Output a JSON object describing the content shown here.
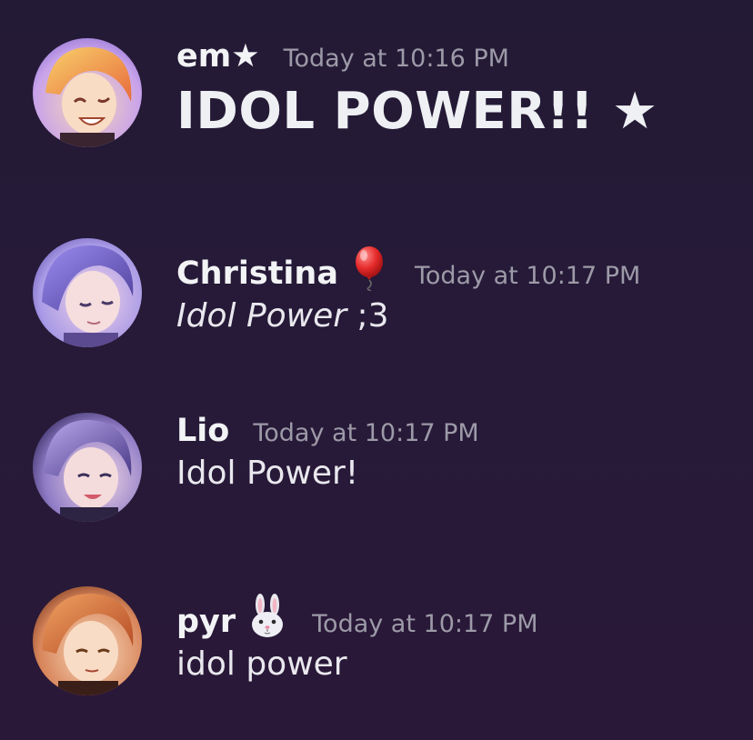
{
  "messages": [
    {
      "username": "em★",
      "username_emoji": "",
      "timestamp": "Today at 10:16 PM",
      "content": "IDOL POWER!! ★",
      "content_style": "large-bold",
      "avatar": {
        "icon": "orange-haired-idol-avatar",
        "colors": [
          "#f3b25a",
          "#e9704a",
          "#b8a0e8"
        ]
      }
    },
    {
      "username": "Christina",
      "username_emoji": "balloon-emoji",
      "timestamp": "Today at 10:17 PM",
      "content_italic": "Idol Power",
      "content_rest": " ;3",
      "avatar": {
        "icon": "purple-haired-idol-avatar",
        "colors": [
          "#8a76e0",
          "#c9b6f4",
          "#e7a7c8"
        ]
      }
    },
    {
      "username": "Lio",
      "username_emoji": "",
      "timestamp": "Today at 10:17 PM",
      "content": "Idol Power!",
      "avatar": {
        "icon": "violet-haired-idol-avatar",
        "colors": [
          "#6d5aa8",
          "#c7b6ea",
          "#f1c8d2"
        ]
      }
    },
    {
      "username": "pyr",
      "username_emoji": "rabbit-face-emoji",
      "timestamp": "Today at 10:17 PM",
      "content": "idol power",
      "avatar": {
        "icon": "ginger-haired-idol-avatar",
        "colors": [
          "#e0803c",
          "#b8502a",
          "#f6d2a8"
        ]
      }
    }
  ],
  "colors": {
    "background": "#251a37",
    "username": "#f2f3f5",
    "timestamp": "#9d9aa8",
    "message_text": "#e9e8ee"
  }
}
